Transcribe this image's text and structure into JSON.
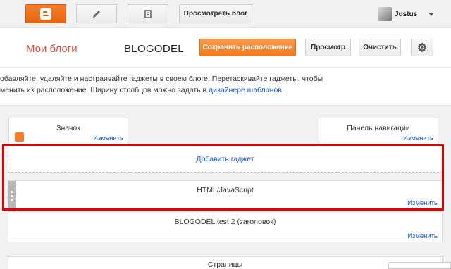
{
  "topbar": {
    "view_blog_label": "Просмотреть блог",
    "user_name": "Justus",
    "icons": [
      "blogger-logo-icon",
      "pencil-icon",
      "posts-list-icon",
      "caret-down-icon"
    ]
  },
  "header": {
    "my_blogs": "Мои блоги",
    "blog_name": "BLOGODEL",
    "save_label": "Сохранить расположение",
    "preview_label": "Просмотр",
    "clear_label": "Очистить",
    "settings_icon": "gear-icon"
  },
  "description": {
    "line1": "обавляйте, удаляйте и настраивайте гаджеты в своем блоге. Перетаскивайте гаджеты, чтобы",
    "line2_prefix": "менить их расположение. Ширину столбцов можно задать в ",
    "line2_link": "дизайнере шаблонов",
    "line2_suffix": "."
  },
  "layout": {
    "icon_gadget": {
      "title": "Значок",
      "edit": "Изменить"
    },
    "nav_gadget": {
      "title": "Панель навигации",
      "edit": "Изменить"
    },
    "add_gadget": "Добавить гаджет",
    "html_gadget": {
      "title": "HTML/JavaScript",
      "edit": "Изменить"
    },
    "header_gadget": {
      "title": "BLOGODEL test 2 (заголовок)",
      "edit": "Изменить"
    },
    "pages_gadget": {
      "title": "Страницы"
    }
  },
  "colors": {
    "brand_orange": "#f57c2a",
    "title_red": "#dd4b39",
    "link_blue": "#1155cc",
    "highlight_red": "#e00000"
  }
}
